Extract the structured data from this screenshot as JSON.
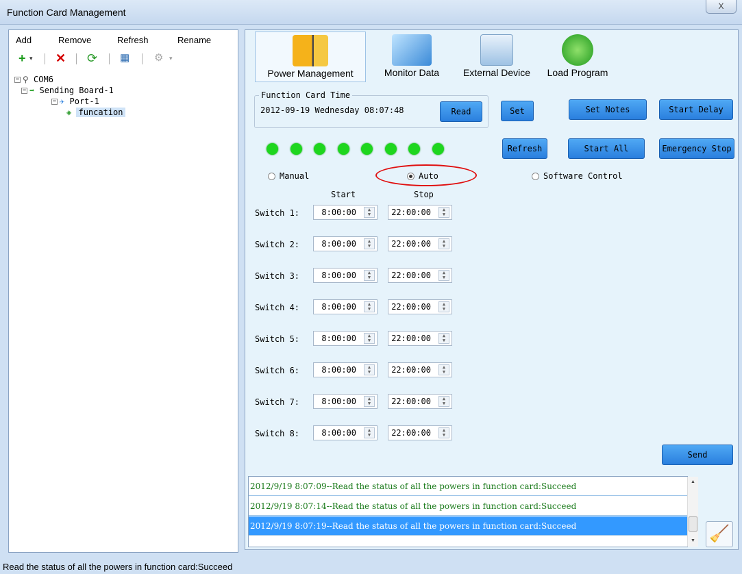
{
  "window": {
    "title": "Function Card Management",
    "close_icon": "X"
  },
  "left": {
    "menu": [
      "Add",
      "Remove",
      "Refresh",
      "Rename"
    ],
    "tree": [
      {
        "label": "COM6"
      },
      {
        "label": "Sending Board-1"
      },
      {
        "label": "Port-1"
      },
      {
        "label": "funcation"
      }
    ]
  },
  "tabs": [
    "Power Management",
    "Monitor Data",
    "External Device",
    "Load Program"
  ],
  "time": {
    "label": "Function Card Time",
    "value": "2012-09-19 Wednesday 08:07:48",
    "read": "Read",
    "set": "Set"
  },
  "buttons": {
    "set_notes": "Set Notes",
    "start_delay": "Start Delay",
    "refresh": "Refresh",
    "start_all": "Start All",
    "emergency_stop": "Emergency Stop",
    "send": "Send"
  },
  "indicators": {
    "count": 8,
    "color": "#1ed61e"
  },
  "mode": {
    "manual": "Manual",
    "auto": "Auto",
    "software": "Software Control",
    "selected": "auto"
  },
  "columns": {
    "start": "Start",
    "stop": "Stop"
  },
  "switches": [
    {
      "label": "Switch 1:",
      "start": "8:00:00",
      "stop": "22:00:00"
    },
    {
      "label": "Switch 2:",
      "start": "8:00:00",
      "stop": "22:00:00"
    },
    {
      "label": "Switch 3:",
      "start": "8:00:00",
      "stop": "22:00:00"
    },
    {
      "label": "Switch 4:",
      "start": "8:00:00",
      "stop": "22:00:00"
    },
    {
      "label": "Switch 5:",
      "start": "8:00:00",
      "stop": "22:00:00"
    },
    {
      "label": "Switch 6:",
      "start": "8:00:00",
      "stop": "22:00:00"
    },
    {
      "label": "Switch 7:",
      "start": "8:00:00",
      "stop": "22:00:00"
    },
    {
      "label": "Switch 8:",
      "start": "8:00:00",
      "stop": "22:00:00"
    }
  ],
  "log": [
    "2012/9/19 8:07:09--Read the status of all the powers in function card:Succeed",
    "2012/9/19 8:07:14--Read the status of all the powers in function card:Succeed",
    "2012/9/19 8:07:19--Read the status of all the powers in function card:Succeed"
  ],
  "status": "Read the status of all the powers in function card:Succeed"
}
